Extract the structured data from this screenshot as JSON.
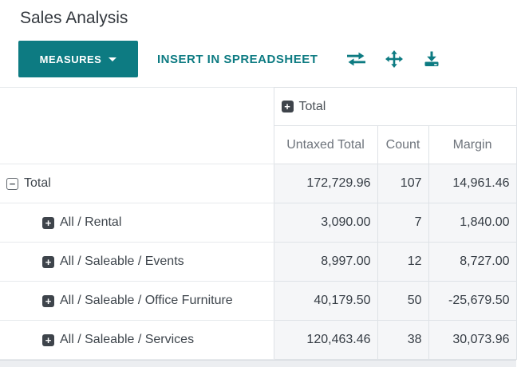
{
  "page": {
    "title": "Sales Analysis"
  },
  "toolbar": {
    "measures_label": "MEASURES",
    "insert_spreadsheet_label": "INSERT IN SPREADSHEET",
    "icon_names": [
      "flip-axis-icon",
      "expand-all-icon",
      "download-icon"
    ]
  },
  "icons": {
    "expand_glyph": "+",
    "collapse_glyph": "−"
  },
  "colors": {
    "accent_teal": "#0d7b82",
    "data_cell_bg": "#f5f6f8",
    "icon_square_dark": "#3e444b"
  },
  "pivot": {
    "column_group": {
      "label": "Total"
    },
    "measure_headers": [
      "Untaxed Total",
      "Count",
      "Margin"
    ],
    "rows": [
      {
        "label": "Total",
        "untaxed_total": "172,729.96",
        "count": "107",
        "margin": "14,961.46"
      },
      {
        "label": "All / Rental",
        "untaxed_total": "3,090.00",
        "count": "7",
        "margin": "1,840.00"
      },
      {
        "label": "All / Saleable / Events",
        "untaxed_total": "8,997.00",
        "count": "12",
        "margin": "8,727.00"
      },
      {
        "label": "All / Saleable / Office Furniture",
        "untaxed_total": "40,179.50",
        "count": "50",
        "margin": "-25,679.50"
      },
      {
        "label": "All / Saleable / Services",
        "untaxed_total": "120,463.46",
        "count": "38",
        "margin": "30,073.96"
      }
    ]
  }
}
